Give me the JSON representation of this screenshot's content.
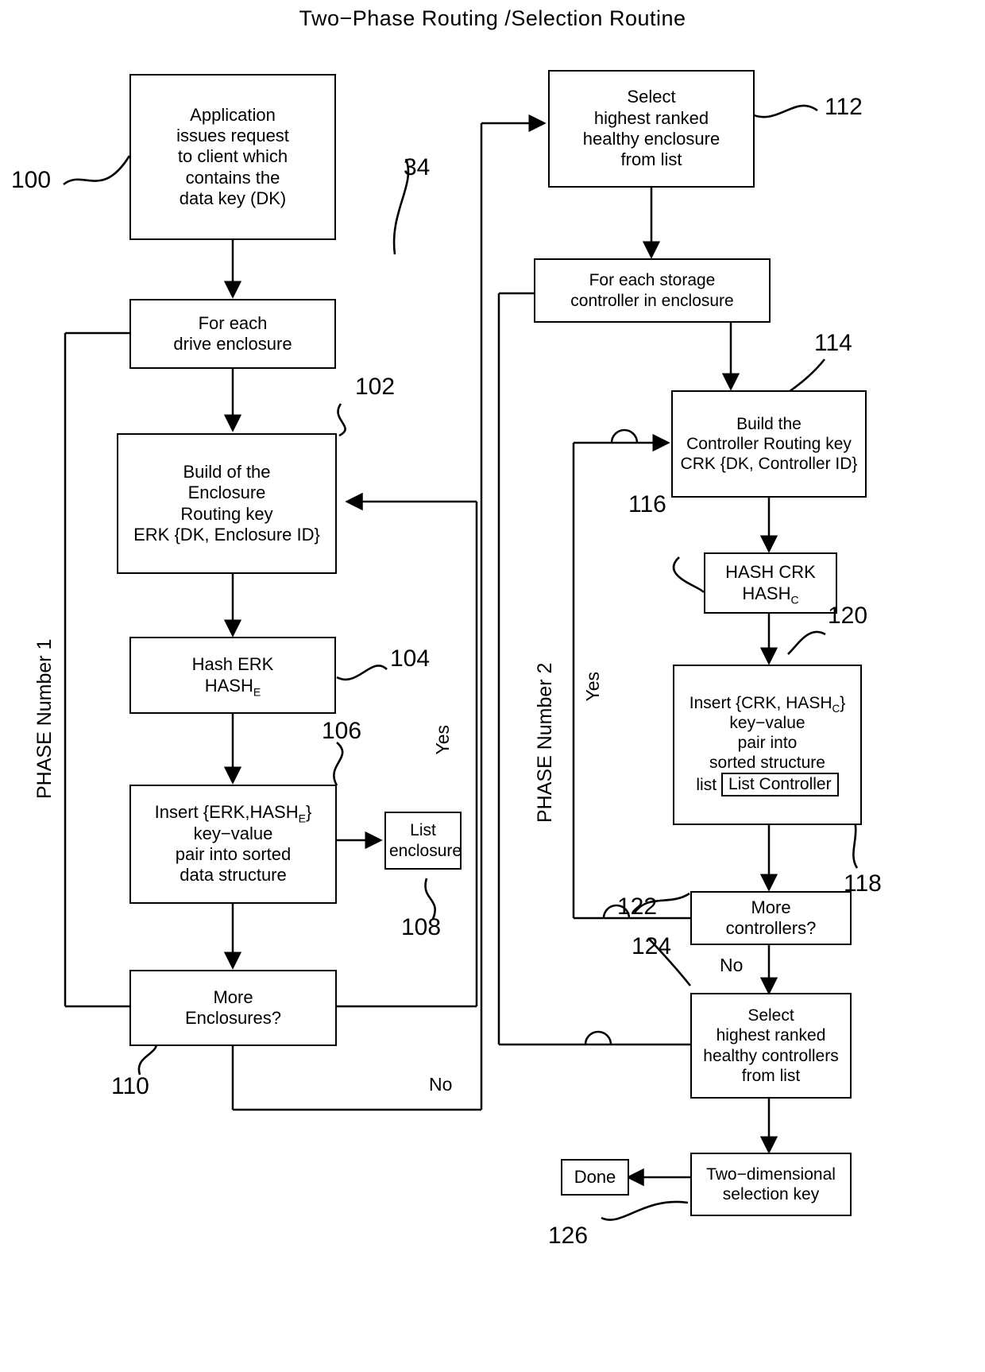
{
  "title": "Two−Phase Routing /Selection Routine",
  "phase_labels": {
    "phase1": "PHASE Number 1",
    "phase2": "PHASE Number 2"
  },
  "nodes": {
    "app_request": "Application\nissues request\nto client which\ncontains the\ndata key (DK)",
    "for_each_enclosure": "For each\ndrive enclosure",
    "build_erk_line1": "Build of the",
    "build_erk_line2": "Enclosure",
    "build_erk_line3": "Routing key",
    "build_erk_line4_a": "ERK {DK, Enclosure ID}",
    "hash_erk_line1": "Hash ERK",
    "hash_erk_line2_main": "HASH",
    "hash_erk_line2_sub": "E",
    "insert_erk_line1_a": "Insert {ERK,HASH",
    "insert_erk_line1_sub": "E",
    "insert_erk_line1_b": "}",
    "insert_erk_line2": "key−value",
    "insert_erk_line3": "pair into sorted",
    "insert_erk_line4": "data structure",
    "list_enclosure": "List\nenclosure",
    "more_enclosures": "More\nEnclosures?",
    "select_enclosure": "Select\nhighest ranked\nhealthy enclosure\nfrom list",
    "for_each_controller": "For each storage\ncontroller in enclosure",
    "build_crk_line1": "Build the",
    "build_crk_line2": "Controller Routing key",
    "build_crk_line3": "CRK {DK, Controller ID}",
    "hash_crk_line1": "HASH CRK",
    "hash_crk_line2_main": "HASH",
    "hash_crk_line2_sub": "C",
    "insert_crk_line1_a": "Insert {CRK, HASH",
    "insert_crk_line1_sub": "C",
    "insert_crk_line1_b": "}",
    "insert_crk_line2": "key−value",
    "insert_crk_line3": "pair into",
    "insert_crk_line4": "sorted structure",
    "insert_crk_line5_prefix": "list",
    "list_controller": "List Controller",
    "more_controllers": "More\ncontrollers?",
    "select_controller": "Select\nhighest ranked\nhealthy controllers\nfrom list",
    "two_dim_key": "Two−dimensional\nselection key",
    "done": "Done"
  },
  "ref_numbers": {
    "r100": "100",
    "r34": "34",
    "r102": "102",
    "r104": "104",
    "r106": "106",
    "r108": "108",
    "r110": "110",
    "r112": "112",
    "r114": "114",
    "r116": "116",
    "r118": "118",
    "r120": "120",
    "r122": "122",
    "r124": "124",
    "r126": "126"
  },
  "edge_labels": {
    "yes_left": "Yes",
    "no_left": "No",
    "yes_right": "Yes",
    "no_right": "No"
  }
}
